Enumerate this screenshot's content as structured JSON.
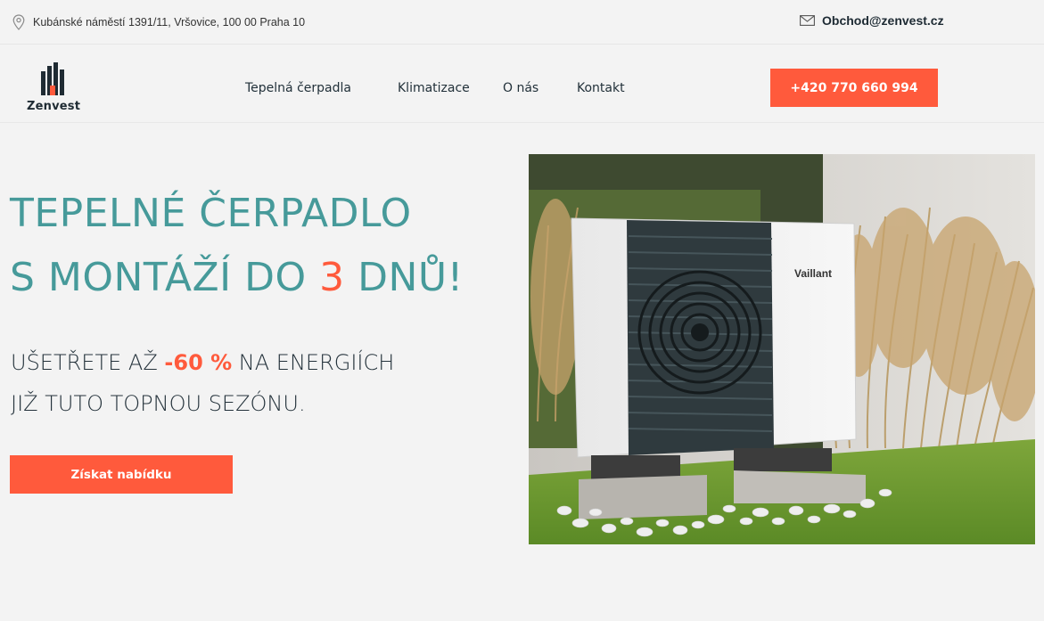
{
  "topbar": {
    "address": "Kubánské náměstí 1391/11, Vršovice, 100 00 Praha 10",
    "address_icon": "map-pin-icon",
    "email": "Obchod@zenvest.cz",
    "email_icon": "envelope-icon"
  },
  "nav": {
    "logo_text": "Zenvest",
    "items": [
      "Tepelná čerpadla",
      "Klimatizace",
      "O nás",
      "Kontakt"
    ],
    "phone": "+420 770 660 994"
  },
  "hero": {
    "title_line1": "TEPELNÉ ČERPADLO",
    "title_line2_pre": "S MONTÁŽÍ DO ",
    "title_line2_num": "3",
    "title_line2_post": " DNŮ!",
    "sub_line1_pre": "UŠETŘETE AŽ ",
    "sub_line1_pct": "-60 %",
    "sub_line1_post": " NA ENERGIÍCH",
    "sub_line2": "JIŽ TUTO TOPNOU SEZÓNU.",
    "cta": "Získat nabídku",
    "photo_brand": "Vaillant"
  },
  "colors": {
    "accent": "#ff5a3c",
    "teal": "#469a9a",
    "background": "#f3f3f3"
  }
}
